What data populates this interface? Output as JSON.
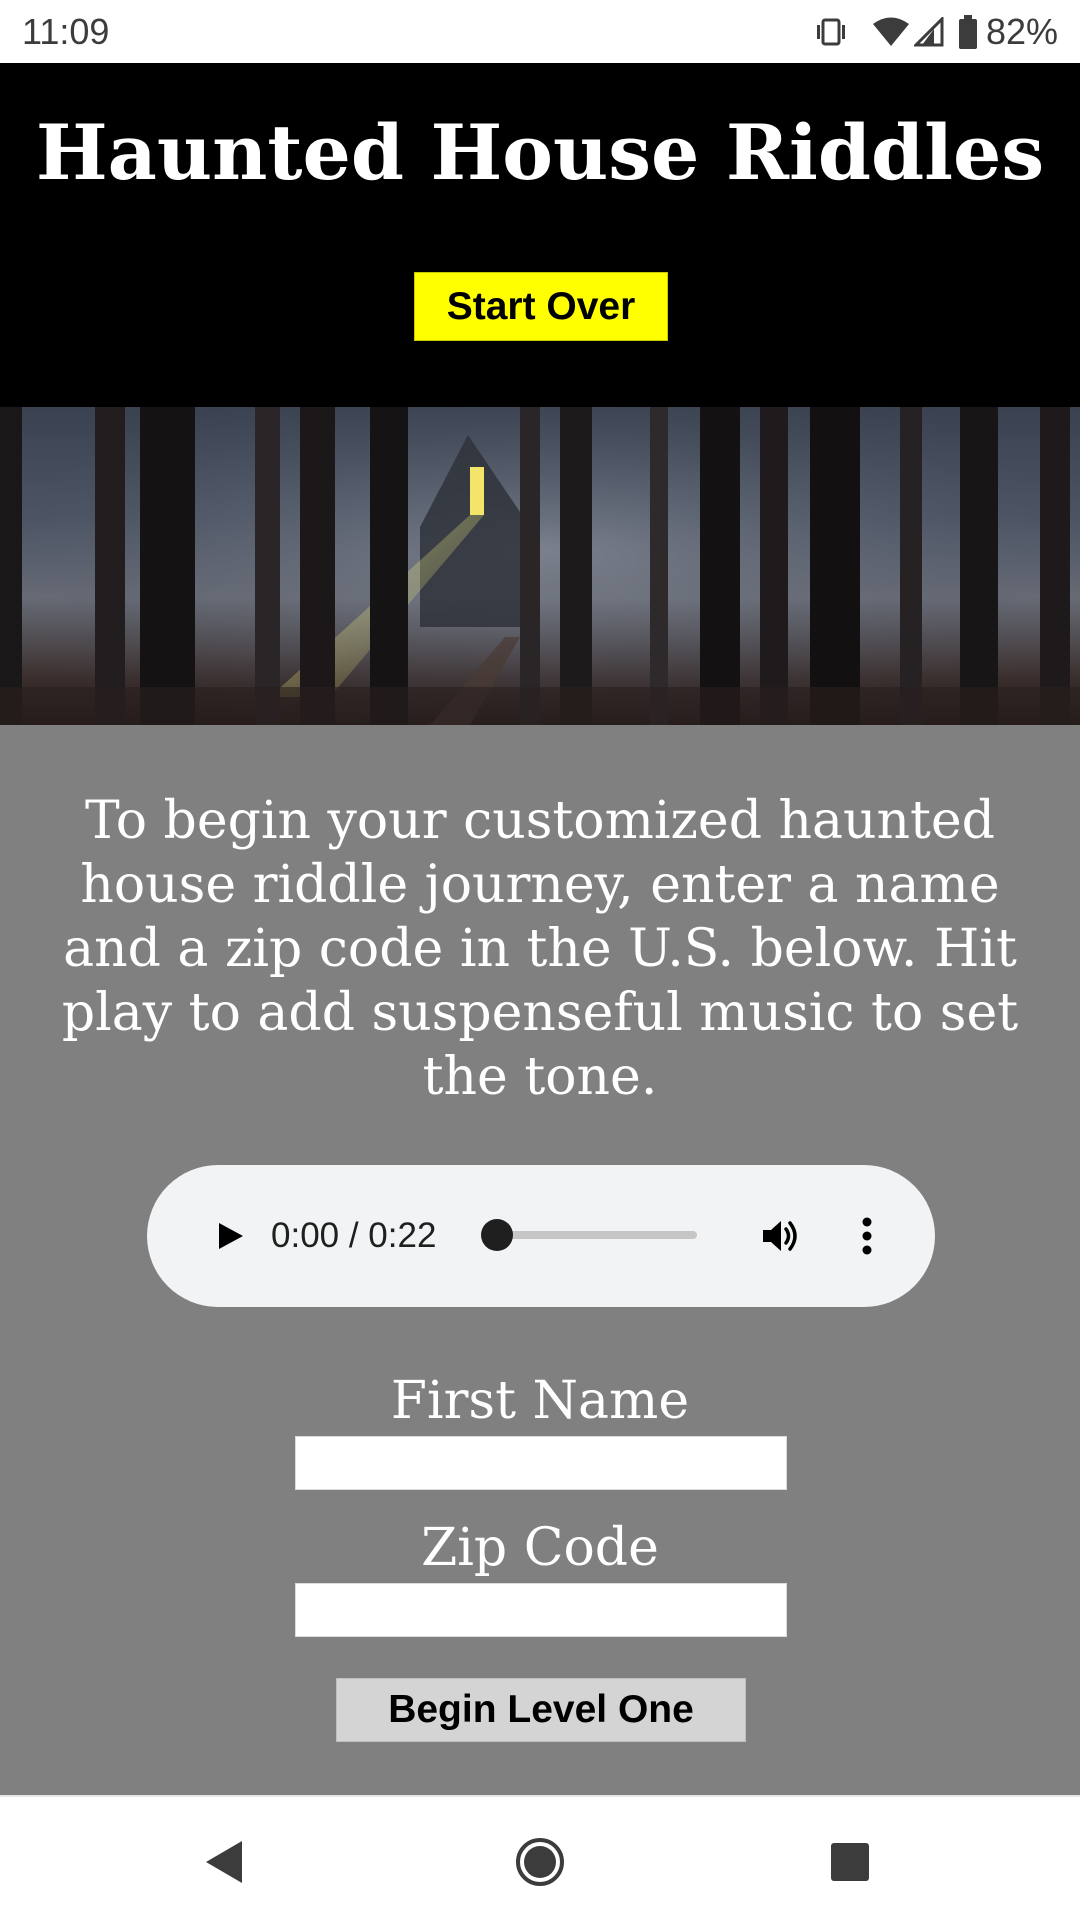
{
  "status_bar": {
    "time": "11:09",
    "battery_percent": "82%",
    "icons": [
      "vibrate-icon",
      "wifi-icon",
      "cell-signal-icon",
      "battery-icon"
    ]
  },
  "header": {
    "title": "Haunted House Riddles",
    "start_over_label": "Start Over",
    "start_over_color": "#ffff00"
  },
  "hero": {
    "description_icon": "haunted-forest-image"
  },
  "intro": {
    "text": "To begin your customized haunted house riddle journey, enter a name and a zip code in the U.S. below. Hit play to add suspenseful music to set the tone."
  },
  "audio": {
    "time_display": "0:00 / 0:22",
    "progress": 0,
    "icons": [
      "play-icon",
      "volume-icon",
      "more-vert-icon"
    ]
  },
  "form": {
    "first_name_label": "First Name",
    "first_name_value": "",
    "zip_label": "Zip Code",
    "zip_value": "",
    "submit_label": "Begin Level One"
  },
  "nav": {
    "icons": [
      "back-icon",
      "home-icon",
      "recents-icon"
    ]
  },
  "colors": {
    "header_bg": "#000000",
    "content_bg": "#808080",
    "audio_bg": "#f1f3f4"
  }
}
